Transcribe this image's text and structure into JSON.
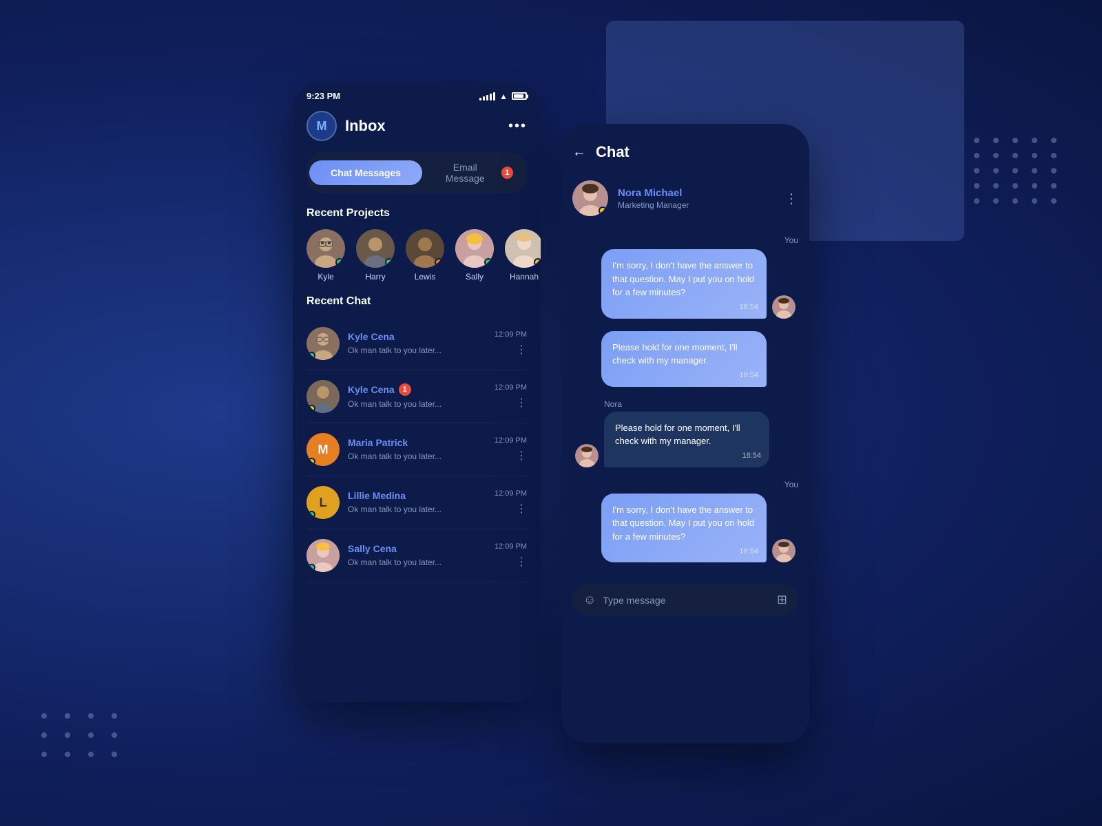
{
  "app": {
    "background_color": "#1a2a6c"
  },
  "status_bar": {
    "time": "9:23 PM"
  },
  "inbox": {
    "title": "Inbox",
    "avatar_letter": "M",
    "tabs": {
      "active": "Chat Messages",
      "inactive": "Email Message",
      "notification_count": "1"
    },
    "recent_projects": {
      "label": "Recent Projects",
      "people": [
        {
          "name": "Kyle",
          "status": "green"
        },
        {
          "name": "Harry",
          "status": "green"
        },
        {
          "name": "Lewis",
          "status": "orange"
        },
        {
          "name": "Sally",
          "status": "green"
        },
        {
          "name": "Hannah",
          "status": "yellow"
        }
      ]
    },
    "recent_chat": {
      "label": "Recent Chat",
      "items": [
        {
          "name": "Kyle Cena",
          "preview": "Ok man talk to you later...",
          "time": "12:09 PM",
          "has_badge": false
        },
        {
          "name": "Kyle Cena",
          "preview": "Ok man talk to you later...",
          "time": "12:09 PM",
          "has_badge": true
        },
        {
          "name": "Maria Patrick",
          "preview": "Ok man talk to you later...",
          "time": "12:09 PM",
          "has_badge": false
        },
        {
          "name": "Lillie Medina",
          "preview": "Ok man talk to you later...",
          "time": "12:09 PM",
          "has_badge": false
        },
        {
          "name": "Sally Cena",
          "preview": "Ok man talk to you later...",
          "time": "12:09 PM",
          "has_badge": false
        }
      ]
    }
  },
  "chat": {
    "title": "Chat",
    "contact": {
      "name": "Nora Michael",
      "role": "Marketing Manager",
      "status": "yellow"
    },
    "messages": [
      {
        "sender": "You",
        "text": "I'm sorry, I don't have the answer to that question. May I put you on hold for a few minutes?",
        "time": "18:54",
        "side": "right"
      },
      {
        "sender": "You",
        "text": "Please hold for one moment, I'll check with my manager.",
        "time": "18:54",
        "side": "right"
      },
      {
        "sender": "Nora",
        "text": "Please hold for one moment, I'll check with my manager.",
        "time": "18:54",
        "side": "left"
      },
      {
        "sender": "You",
        "text": "I'm sorry, I don't have the answer to that question. May I put you on hold for a few minutes?",
        "time": "18:54",
        "side": "right"
      }
    ],
    "input_placeholder": "Type message"
  }
}
